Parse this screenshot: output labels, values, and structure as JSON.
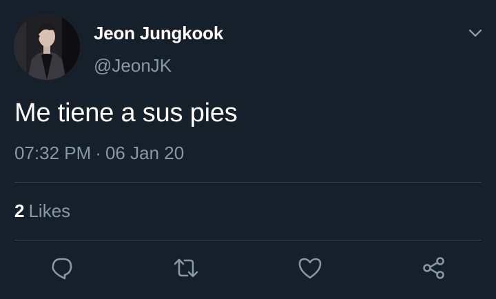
{
  "tweet": {
    "display_name": "Jeon Jungkook",
    "handle": "@JeonJK",
    "text": "Me tiene a sus pies",
    "time": "07:32 PM",
    "separator": "·",
    "date": "06 Jan 20",
    "likes_count": "2",
    "likes_label": "Likes"
  },
  "icons": {
    "caret": "chevron-down-icon",
    "reply": "reply-icon",
    "retweet": "retweet-icon",
    "like": "heart-icon",
    "share": "share-icon"
  },
  "colors": {
    "background": "#16202b",
    "primary_text": "#ffffff",
    "secondary_text": "#8899a6",
    "divider": "#38444d"
  }
}
